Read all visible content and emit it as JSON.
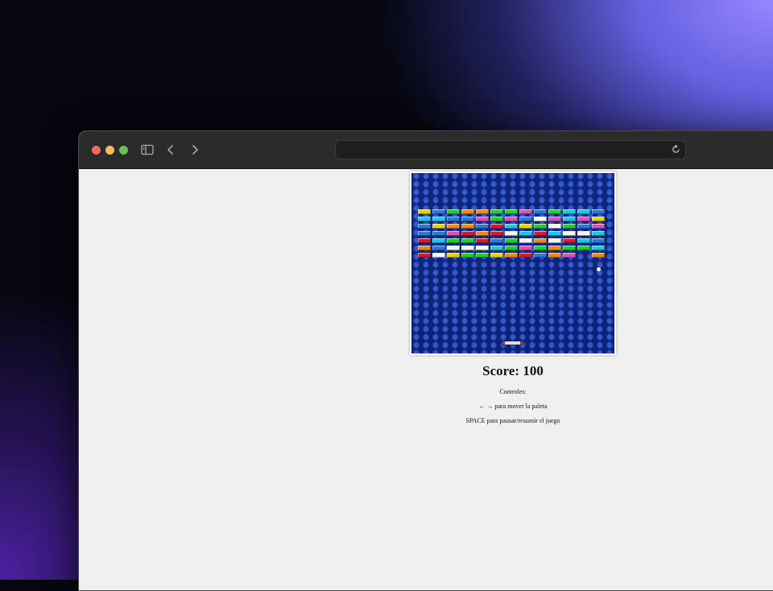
{
  "browser": {
    "address_text": "",
    "icons": [
      "close-dot",
      "minimize-dot",
      "zoom-dot",
      "sidebar-icon",
      "back-icon",
      "forward-icon",
      "reload-icon"
    ]
  },
  "game": {
    "score_label": "Score: 100",
    "controls_title": "Controles:",
    "controls_move": "← → para mover la paleta",
    "controls_pause": "SPACE para pausar/resumir el juego",
    "brick_columns": 13,
    "brick_rows": [
      [
        "yellow",
        "blue",
        "green",
        "orange",
        "orange",
        "green",
        "green",
        "magenta",
        "blue",
        "green",
        "cyan",
        "cyan",
        "blue"
      ],
      [
        "cyan",
        "cyan",
        "blue",
        "blue",
        "magenta",
        "green",
        "magenta",
        "blue",
        "white",
        "magenta",
        "cyan",
        "magenta",
        "yellow"
      ],
      [
        "blue",
        "yellow",
        "orange",
        "orange",
        "blue",
        "red",
        "cyan",
        "yellow",
        "green",
        "white",
        "green",
        "blue",
        "magenta"
      ],
      [
        "blue",
        "blue",
        "magenta",
        "red",
        "orange",
        "red",
        "white",
        "cyan",
        "red",
        "cyan",
        "white",
        "white",
        "cyan"
      ],
      [
        "red",
        "cyan",
        "green",
        "green",
        "red",
        "blue",
        "green",
        "white",
        "orange",
        "white",
        "red",
        "cyan",
        "blue"
      ],
      [
        "orange",
        "blue",
        "white",
        "white",
        "white",
        "cyan",
        "green",
        "magenta",
        "green",
        "orange",
        "green",
        "green",
        "cyan"
      ],
      [
        "red",
        "white",
        "yellow",
        "green",
        "green",
        "yellow",
        "orange",
        "red",
        "blue",
        "orange",
        "magenta",
        "",
        "orange"
      ]
    ],
    "brick_colors": {
      "yellow": "#e8d400",
      "blue": "#2a78d8",
      "green": "#1ed02c",
      "orange": "#f08a10",
      "magenta": "#e050b8",
      "cyan": "#1cc8e8",
      "white": "#f4f4f4",
      "red": "#d21c2c"
    },
    "playfield_color": "#1838a8",
    "paddle_color": "#d8d8d8"
  }
}
